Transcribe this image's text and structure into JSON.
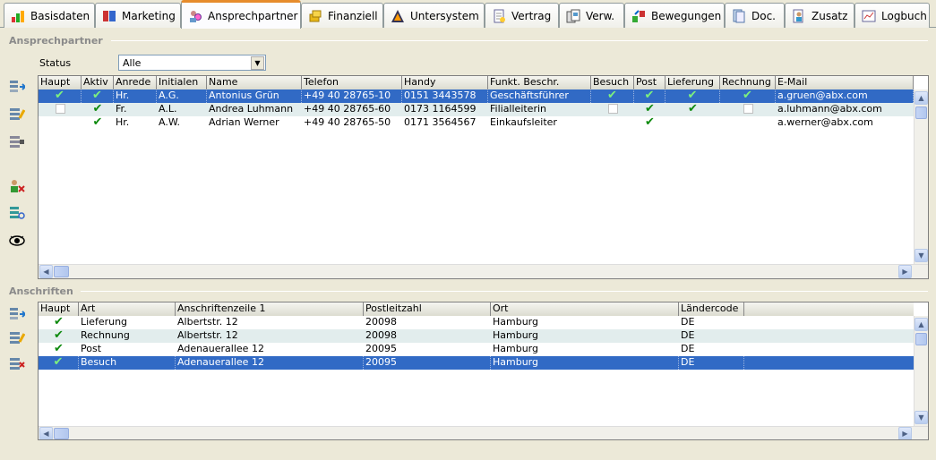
{
  "tabs": [
    {
      "label": "Basisdaten",
      "icon": "chart-icon"
    },
    {
      "label": "Marketing",
      "icon": "marketing-icon"
    },
    {
      "label": "Ansprechpartner",
      "icon": "contacts-icon",
      "active": true
    },
    {
      "label": "Finanziell",
      "icon": "coins-icon"
    },
    {
      "label": "Untersystem",
      "icon": "tree-icon"
    },
    {
      "label": "Vertrag",
      "icon": "contract-icon"
    },
    {
      "label": "Verw.",
      "icon": "documents-icon"
    },
    {
      "label": "Bewegungen",
      "icon": "movements-icon"
    },
    {
      "label": "Doc.",
      "icon": "doc-icon"
    },
    {
      "label": "Zusatz",
      "icon": "extra-icon"
    },
    {
      "label": "Logbuch",
      "icon": "logbook-icon"
    }
  ],
  "contacts": {
    "section_title": "Ansprechpartner",
    "status_label": "Status",
    "status_value": "Alle",
    "side_icons": [
      "add-contact-icon",
      "edit-contact-icon",
      "delete-contact-icon",
      "remove-user-icon",
      "list-link-icon",
      "view-icon"
    ],
    "columns": [
      "Haupt",
      "Aktiv",
      "Anrede",
      "Initialen",
      "Name",
      "Telefon",
      "Handy",
      "Funkt. Beschr.",
      "Besuch",
      "Post",
      "Lieferung",
      "Rechnung",
      "E-Mail"
    ],
    "rows": [
      {
        "haupt": true,
        "aktiv": true,
        "anrede": "Hr.",
        "initialen": "A.G.",
        "name": "Antonius Grün",
        "telefon": "+49 40 28765-10",
        "handy": "0151 3443578",
        "funkt": "Geschäftsführer",
        "besuch": true,
        "post": true,
        "lieferung": true,
        "rechnung": true,
        "email": "a.gruen@abx.com",
        "selected": true
      },
      {
        "haupt": false,
        "aktiv": true,
        "anrede": "Fr.",
        "initialen": "A.L.",
        "name": "Andrea Luhmann",
        "telefon": "+49 40 28765-60",
        "handy": "0173 1164599",
        "funkt": "Filialleiterin",
        "besuch": false,
        "post": true,
        "lieferung": true,
        "rechnung": false,
        "email": "a.luhmann@abx.com"
      },
      {
        "haupt": null,
        "aktiv": true,
        "anrede": "Hr.",
        "initialen": "A.W.",
        "name": "Adrian Werner",
        "telefon": "+49 40 28765-50",
        "handy": "0171 3564567",
        "funkt": "Einkaufsleiter",
        "besuch": null,
        "post": true,
        "lieferung": null,
        "rechnung": null,
        "email": "a.werner@abx.com"
      }
    ]
  },
  "addresses": {
    "section_title": "Anschriften",
    "side_icons": [
      "add-address-icon",
      "edit-address-icon",
      "delete-address-icon"
    ],
    "columns": [
      "Haupt",
      "Art",
      "Anschriftenzeile 1",
      "Postleitzahl",
      "Ort",
      "Ländercode"
    ],
    "rows": [
      {
        "haupt": true,
        "art": "Lieferung",
        "zeile1": "Albertstr. 12",
        "plz": "20098",
        "ort": "Hamburg",
        "land": "DE"
      },
      {
        "haupt": true,
        "art": "Rechnung",
        "zeile1": "Albertstr. 12",
        "plz": "20098",
        "ort": "Hamburg",
        "land": "DE"
      },
      {
        "haupt": true,
        "art": "Post",
        "zeile1": "Adenauerallee 12",
        "plz": "20095",
        "ort": "Hamburg",
        "land": "DE"
      },
      {
        "haupt": true,
        "art": "Besuch",
        "zeile1": "Adenauerallee 12",
        "plz": "20095",
        "ort": "Hamburg",
        "land": "DE",
        "selected": true
      }
    ]
  },
  "colors": {
    "selection": "#316ac5",
    "alt_row": "#e2eded",
    "check": "#0e8a0e",
    "tab_accent": "#e68b2c"
  }
}
